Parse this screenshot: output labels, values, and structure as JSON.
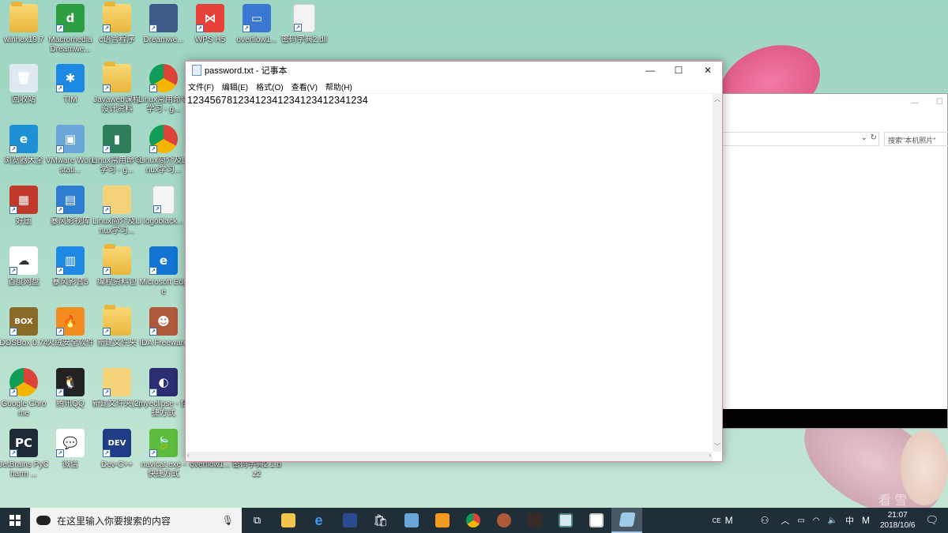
{
  "desktop_icons": [
    {
      "label": "winhex19.7",
      "kind": "folder"
    },
    {
      "label": "Macromedia Dreamwe...",
      "kind": "dreamweaver"
    },
    {
      "label": "c语言程序",
      "kind": "folder"
    },
    {
      "label": "Dreamwe...",
      "kind": "dw2"
    },
    {
      "label": "WPS H5",
      "kind": "wps"
    },
    {
      "label": "overflow1...",
      "kind": "exe"
    },
    {
      "label": "密码字典2.dll",
      "kind": "file"
    },
    {
      "label": "回收站",
      "kind": "recycle"
    },
    {
      "label": "TIM",
      "kind": "tim"
    },
    {
      "label": "Javaweb课程设计资料",
      "kind": "folder"
    },
    {
      "label": "Linux常用命令学习 - g...",
      "kind": "chrome"
    },
    {
      "label": "浏览器大全",
      "kind": "ie"
    },
    {
      "label": "VMware Workstati...",
      "kind": "vmware"
    },
    {
      "label": "Linux常用命令学习 - g...",
      "kind": "book"
    },
    {
      "label": "Linux简介及Linux学习...",
      "kind": "chrome"
    },
    {
      "label": "好压",
      "kind": "haozip"
    },
    {
      "label": "暴风影视库",
      "kind": "storm"
    },
    {
      "label": "Linux简介及Linux学习...",
      "kind": "folderdoc"
    },
    {
      "label": "logoblack...",
      "kind": "img"
    },
    {
      "label": "百度网盘",
      "kind": "baidu"
    },
    {
      "label": "暴风影音5",
      "kind": "storm2"
    },
    {
      "label": "编程资料包",
      "kind": "folder"
    },
    {
      "label": "Microsoft Edge",
      "kind": "edge"
    },
    {
      "label": "DOSBox 0.74",
      "kind": "dosbox"
    },
    {
      "label": "火绒安全软件",
      "kind": "huorong"
    },
    {
      "label": "新建文件夹",
      "kind": "folder"
    },
    {
      "label": "IDA Freeware",
      "kind": "ida"
    },
    {
      "label": "Google Chrome",
      "kind": "chrome"
    },
    {
      "label": "腾讯QQ",
      "kind": "qq"
    },
    {
      "label": "新建文件夹(2)",
      "kind": "folderdoc"
    },
    {
      "label": "myeclipse - 快捷方式",
      "kind": "eclipse"
    },
    {
      "label": "JetBrains PyCharm ...",
      "kind": "pycharm"
    },
    {
      "label": "微信",
      "kind": "wechat"
    },
    {
      "label": "Dev-C++",
      "kind": "dev"
    },
    {
      "label": "navicat.exe - 快捷方式",
      "kind": "navicat"
    },
    {
      "label": "overflow1...",
      "kind": "none"
    },
    {
      "label": "密码字典2.1.bz2",
      "kind": "none"
    }
  ],
  "explorer": {
    "search_placeholder": "搜索\"本机照片\""
  },
  "notepad": {
    "title": "password.txt - 记事本",
    "menu": [
      "文件(F)",
      "编辑(E)",
      "格式(O)",
      "查看(V)",
      "帮助(H)"
    ],
    "content": "12345678123412341234123412341234"
  },
  "taskbar": {
    "search_placeholder": "在这里输入你要搜索的内容",
    "ime": "CE",
    "ime2": "M",
    "ime3": "中",
    "ime4": "M",
    "time": "21:07",
    "date": "2018/10/6"
  },
  "watermark": "看雪"
}
